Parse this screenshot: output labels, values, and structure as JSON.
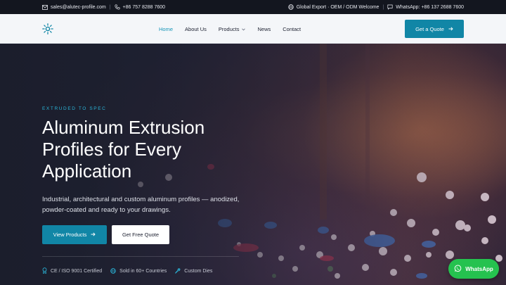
{
  "topbar": {
    "email": "sales@alutec-profile.com",
    "phone": "+86 757 8288 7600",
    "tagline": "Global Export · OEM / ODM Welcome",
    "whatsapp": "WhatsApp: +86 137 2688 7600"
  },
  "header": {
    "nav": [
      "Home",
      "About Us",
      "Products",
      "News",
      "Contact"
    ],
    "quote_label": "Get a Quote"
  },
  "hero": {
    "eyebrow": "EXTRUDED TO SPEC",
    "title": "Aluminum Extrusion Profiles for Every Application",
    "lead": "Industrial, architectural and custom aluminum profiles — anodized, powder-coated and ready to your drawings.",
    "primary_label": "View Products",
    "secondary_label": "Get Free Quote",
    "features": [
      "CE / ISO 9001 Certified",
      "Sold in 60+ Countries",
      "Custom Dies"
    ]
  },
  "floating": {
    "whatsapp_label": "WhatsApp"
  },
  "colors": {
    "accent": "#1186a6",
    "eyebrow": "#2bb5d9",
    "whatsapp": "#25c24f",
    "topbar": "#13161f"
  }
}
